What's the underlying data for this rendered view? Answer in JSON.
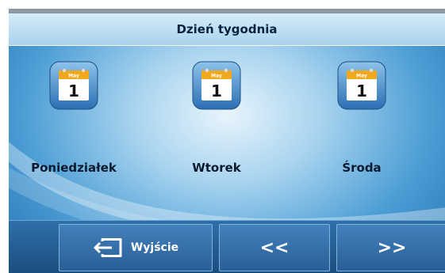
{
  "header": {
    "title": "Dzień tygodnia"
  },
  "days": [
    {
      "label": "Poniedziałek",
      "icon": "calendar-icon",
      "month": "May",
      "day": "1"
    },
    {
      "label": "Wtorek",
      "icon": "calendar-icon",
      "month": "May",
      "day": "1"
    },
    {
      "label": "Środa",
      "icon": "calendar-icon",
      "month": "May",
      "day": "1"
    }
  ],
  "footer": {
    "exit_label": "Wyjście",
    "exit_icon": "exit-icon",
    "prev_label": "<<",
    "next_label": ">>"
  },
  "colors": {
    "title_text": "#0a2340",
    "calendar_header": "#f2a81c",
    "button_bg": "#3a74ad"
  }
}
